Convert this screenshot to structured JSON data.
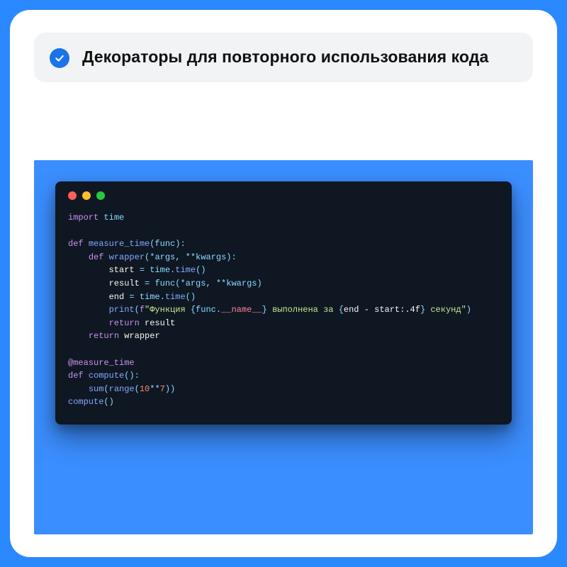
{
  "header": {
    "check_icon": "check-icon",
    "title": "Декораторы для повторного использования кода"
  },
  "terminal": {
    "traffic_lights": [
      "red",
      "yellow",
      "green"
    ]
  },
  "code": {
    "l01_import": "import",
    "l01_time": "time",
    "l03_def": "def",
    "l03_fn": "measure_time",
    "l03_params": "(func):",
    "l04_def": "def",
    "l04_fn": "wrapper",
    "l04_params": "(*args, **kwargs):",
    "l05_lhs": "start",
    "l05_eq": " = ",
    "l05_obj": "time",
    "l05_dot": ".",
    "l05_call": "time",
    "l05_par": "()",
    "l06_lhs": "result",
    "l06_eq": " = ",
    "l06_obj": "func",
    "l06_par": "(*args, **kwargs)",
    "l07_lhs": "end",
    "l07_eq": " = ",
    "l07_obj": "time",
    "l07_dot": ".",
    "l07_call": "time",
    "l07_par": "()",
    "l08_print": "print",
    "l08_open": "(",
    "l08_fpre": "f",
    "l08_q1": "\"",
    "l08_s1": "Функция ",
    "l08_b1o": "{",
    "l08_e1a": "func",
    "l08_e1d": ".",
    "l08_e1b": "__name__",
    "l08_b1c": "}",
    "l08_s2": " выполнена за ",
    "l08_b2o": "{",
    "l08_e2": "end - start:.4f",
    "l08_b2c": "}",
    "l08_s3": " секунд",
    "l08_q2": "\"",
    "l08_close": ")",
    "l09_ret": "return",
    "l09_val": " result",
    "l10_ret": "return",
    "l10_val": " wrapper",
    "l12_dec": "@measure_time",
    "l13_def": "def",
    "l13_fn": "compute",
    "l13_par": "():",
    "l14_sum": "sum",
    "l14_open": "(",
    "l14_range": "range",
    "l14_ropen": "(",
    "l14_base": "10",
    "l14_op": "**",
    "l14_exp": "7",
    "l14_rclose": "))",
    "l15_call": "compute",
    "l15_par": "()"
  }
}
